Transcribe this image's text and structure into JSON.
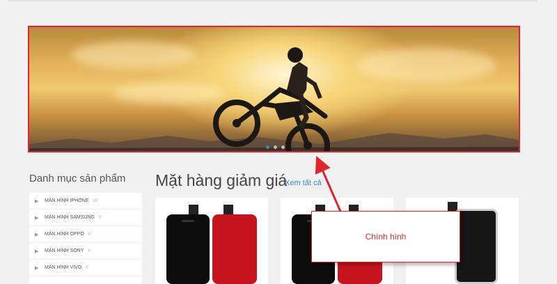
{
  "banner": {
    "active_slide": 1,
    "slide_count": 3
  },
  "sidebar": {
    "title": "Danh mục sản phẩm",
    "items": [
      {
        "label": "MÀN HÌNH IPHONE",
        "count": "10"
      },
      {
        "label": "MÀN HÌNH SAMSUNG",
        "count": "0"
      },
      {
        "label": "MÀN HÌNH OPPO",
        "count": "0"
      },
      {
        "label": "MÀN HÌNH SONY",
        "count": "0"
      },
      {
        "label": "MÀN HÌNH VIVO",
        "count": "0"
      }
    ]
  },
  "main": {
    "title": "Mặt hàng giảm giá",
    "see_all": "Xem tất cả"
  },
  "annotation": {
    "label": "Chính hình"
  },
  "colors": {
    "accent": "#e0262c",
    "link": "#3a8bd6",
    "dot_active": "#3a85d6"
  }
}
